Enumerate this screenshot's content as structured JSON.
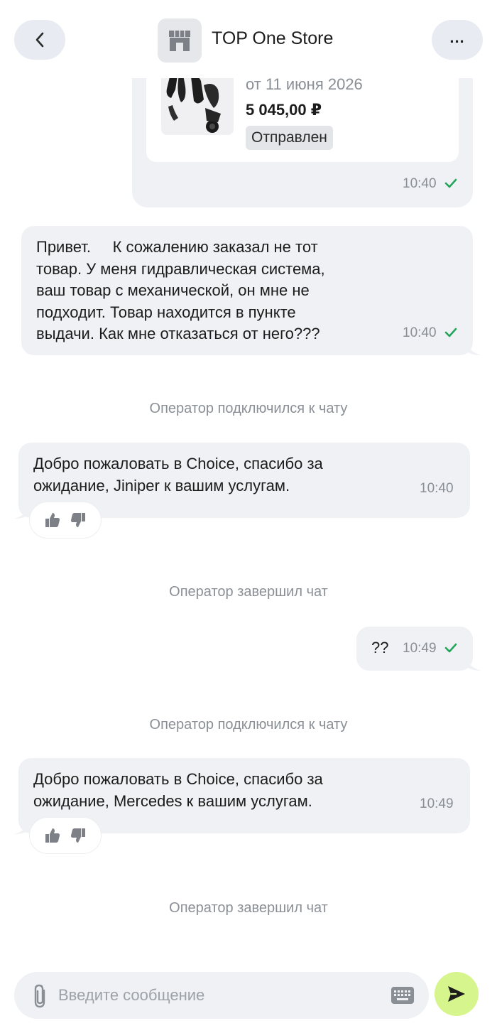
{
  "header": {
    "title": "TOP One Store",
    "more_label": "..."
  },
  "order": {
    "date": "от 11 июня 2026",
    "price": "5 045,00 ₽",
    "status": "Отправлен",
    "time": "10:40"
  },
  "messages": [
    {
      "text": "Привет.     К сожалению заказал не тот\nтовар. У меня гидравлическая система,\nваш товар с механической, он мне не\nподходит. Товар находится в пункте\nвыдачи. Как мне отказаться от него???",
      "time": "10:40"
    },
    {
      "text": "Добро пожаловать в Choice, спасибо за\nожидание, Jiniper к вашим услугам.",
      "time": "10:40"
    },
    {
      "text": "??",
      "time": "10:49"
    },
    {
      "text": "Добро пожаловать в Choice, спасибо за\nожидание, Mercedes к вашим услугам.",
      "time": "10:49"
    }
  ],
  "system": {
    "joined_1": "Оператор подключился к чату",
    "ended_1": "Оператор завершил чат",
    "joined_2": "Оператор подключился к чату",
    "ended_2": "Оператор завершил чат"
  },
  "input": {
    "placeholder": "Введите сообщение"
  },
  "colors": {
    "bubble": "#eff1f4",
    "check": "#22a55a",
    "send": "#d6f58c",
    "muted_text": "#8a8f96"
  }
}
